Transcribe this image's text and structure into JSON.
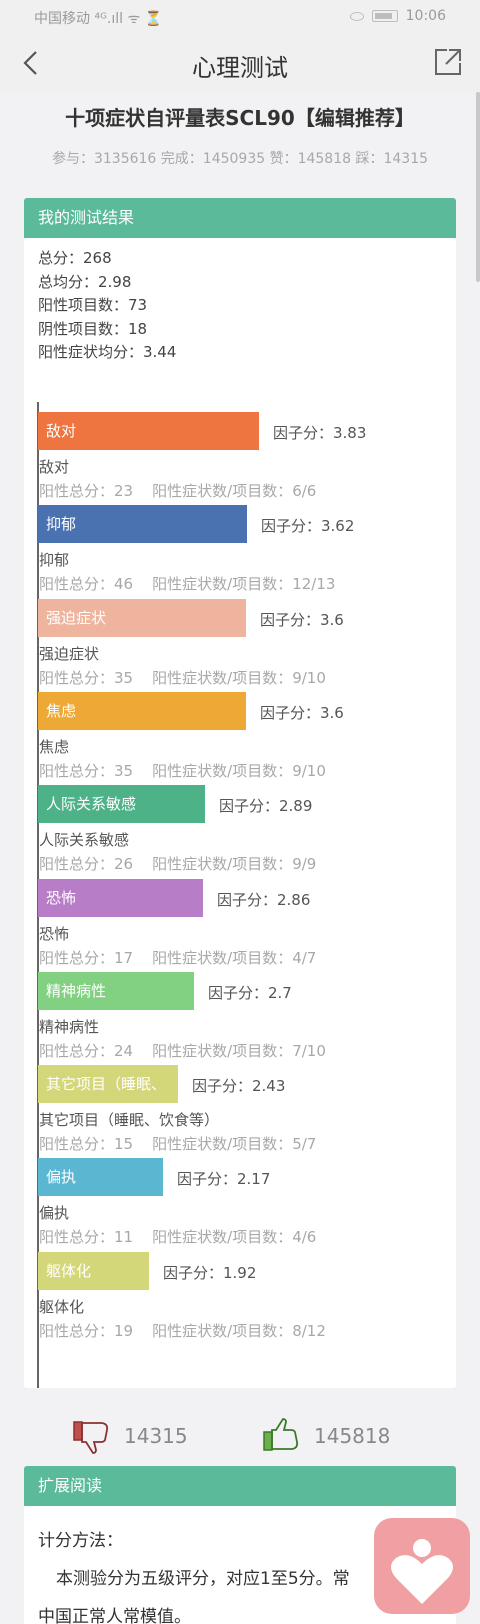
{
  "status": {
    "carrier": "中国移动",
    "signal": "⁴ᴳ.ıll ᯤ ⏳",
    "time": "10:06"
  },
  "titlebar": {
    "title": "心理测试"
  },
  "test": {
    "title": "十项症状自评量表SCL90【编辑推荐】",
    "stats": "参与：3135616 完成：1450935 赞：145818 踩：14315"
  },
  "result": {
    "header": "我的测试结果",
    "summary": [
      "总分：268",
      "总均分：2.98",
      "阳性项目数：73",
      "阴性项目数：18",
      "阳性症状均分：3.44"
    ],
    "factors": [
      {
        "bar_label": "敌对",
        "score": "因子分：3.83",
        "value": 3.83,
        "name": "敌对",
        "stat": "阳性总分：23    阳性症状数/项目数：6/6",
        "color": "#ee7440",
        "label_color": "#ffffff"
      },
      {
        "bar_label": "抑郁",
        "score": "因子分：3.62",
        "value": 3.62,
        "name": "抑郁",
        "stat": "阳性总分：46    阳性症状数/项目数：12/13",
        "color": "#4a72b1",
        "label_color": "#ffffff"
      },
      {
        "bar_label": "强迫症状",
        "score": "因子分：3.6",
        "value": 3.6,
        "name": "强迫症状",
        "stat": "阳性总分：35    阳性症状数/项目数：9/10",
        "color": "#eeb49e",
        "label_color": "#ffffff"
      },
      {
        "bar_label": "焦虑",
        "score": "因子分：3.6",
        "value": 3.6,
        "name": "焦虑",
        "stat": "阳性总分：35    阳性症状数/项目数：9/10",
        "color": "#eda835",
        "label_color": "#ffffff"
      },
      {
        "bar_label": "人际关系敏感",
        "score": "因子分：2.89",
        "value": 2.89,
        "name": "人际关系敏感",
        "stat": "阳性总分：26    阳性症状数/项目数：9/9",
        "color": "#4db287",
        "label_color": "#ffffff"
      },
      {
        "bar_label": "恐怖",
        "score": "因子分：2.86",
        "value": 2.86,
        "name": "恐怖",
        "stat": "阳性总分：17    阳性症状数/项目数：4/7",
        "color": "#b87dc7",
        "label_color": "#ffffff"
      },
      {
        "bar_label": "精神病性",
        "score": "因子分：2.7",
        "value": 2.7,
        "name": "精神病性",
        "stat": "阳性总分：24    阳性症状数/项目数：7/10",
        "color": "#82d182",
        "label_color": "#ffffff"
      },
      {
        "bar_label": "其它项目（睡眠、",
        "score": "因子分：2.43",
        "value": 2.43,
        "name": "其它项目（睡眠、饮食等）",
        "stat": "阳性总分：15    阳性症状数/项目数：5/7",
        "color": "#d4d67a",
        "label_color": "#ffffff"
      },
      {
        "bar_label": "偏执",
        "score": "因子分：2.17",
        "value": 2.17,
        "name": "偏执",
        "stat": "阳性总分：11    阳性症状数/项目数：4/6",
        "color": "#5bb6d2",
        "label_color": "#ffffff"
      },
      {
        "bar_label": "躯体化",
        "score": "因子分：1.92",
        "value": 1.92,
        "name": "躯体化",
        "stat": "阳性总分：19    阳性症状数/项目数：8/12",
        "color": "#d4d67a",
        "label_color": "#ffffff"
      }
    ]
  },
  "votes": {
    "dislike": "14315",
    "like": "145818"
  },
  "extended": {
    "header": "扩展阅读",
    "method_title": "计分方法：",
    "line1": "本测验分为五级评分，对应1至5分。常",
    "line2": "中国正常人常模值。"
  },
  "colors": {
    "accent": "#5bba9a",
    "fab": "#f0a0a3"
  },
  "icons": [
    "back-icon",
    "share-icon",
    "dislike-icon",
    "like-icon",
    "heart-icon"
  ]
}
